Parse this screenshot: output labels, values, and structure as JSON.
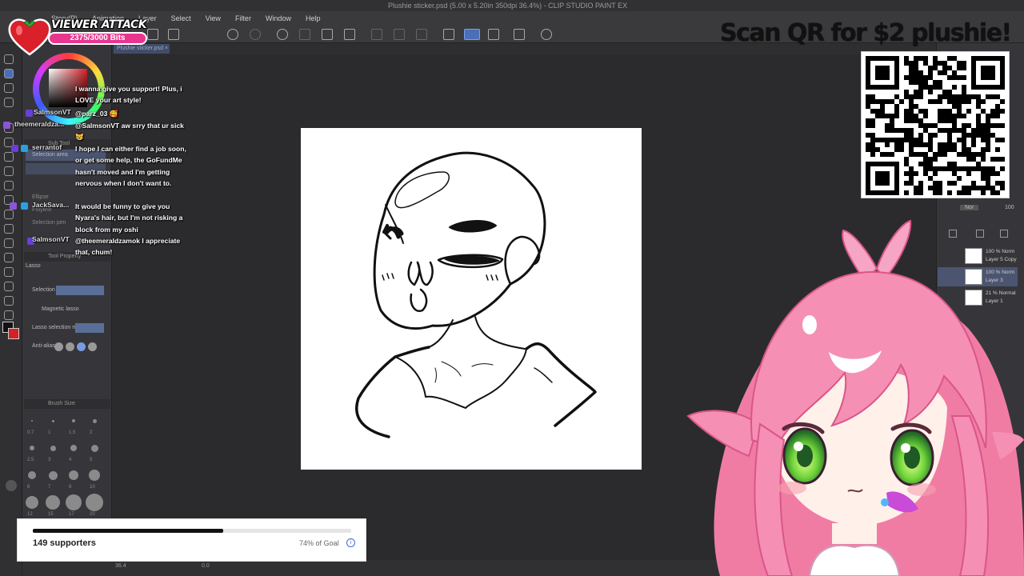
{
  "window": {
    "title": "Plushie sticker.psd (5.00 x 5.20in 350dpi 36.4%) - CLIP STUDIO PAINT EX",
    "doc_tab": "Plushie sticker.psd",
    "menu": [
      "Story(P)",
      "Animation",
      "Layer",
      "Select",
      "View",
      "Filter",
      "Window",
      "Help"
    ]
  },
  "left_panel": {
    "sub_tool_header": "Sub Tool",
    "sub_tools": [
      "Selection area",
      "Ellipse",
      "Polyline",
      "Selection pen"
    ],
    "tool_property_header": "Tool Property",
    "tool_name": "Lasso",
    "selection_label": "Selection",
    "magnetic_lasso": "Magnetic lasso",
    "lasso_mode": "Lasso selection mode",
    "anti_alias": "Anti-alias",
    "brush_size_header": "Brush Size",
    "brush_sizes": [
      "0.7",
      "1",
      "1.5",
      "2",
      "2.5",
      "3",
      "4",
      "5",
      "6",
      "7",
      "8",
      "10",
      "12",
      "15",
      "17",
      "20"
    ],
    "status_zoom": "36.4",
    "status_angle": "0.0"
  },
  "right_panel": {
    "blend_mode": "Nor",
    "opacity": "100",
    "layers": [
      {
        "pct": "100 % Norm",
        "name": "Layer 5 Copy"
      },
      {
        "pct": "100 % Norm",
        "name": "Layer 3"
      },
      {
        "pct": "21 % Normal",
        "name": "Layer 1"
      }
    ]
  },
  "viewer_attack": {
    "title": "VIEWER ATTACK",
    "bits": "2375/3000 Bits",
    "progress": 0.79
  },
  "chat": [
    {
      "user": "",
      "color": "#ffffff",
      "text": "I wanna give you support! Plus, i LOVE your art style!"
    },
    {
      "user": "SalmsonVT",
      "color": "#4b9bff",
      "text": "@parz_03 🥰"
    },
    {
      "user": "theemeraldza...",
      "color": "#b36bff",
      "text": "@SalmsonVT aw srry that ur sick 😿"
    },
    {
      "user": "serrantof",
      "color": "#4b9bff",
      "text": "I hope I can either find a job soon, or get some help, the GoFundMe hasn't moved and I'm getting nervous when I don't want to."
    },
    {
      "user": "JackSava...",
      "color": "#5cff5c",
      "text": "It would be funny to give you Nyara's hair, but I'm not risking a block from my oshi"
    },
    {
      "user": "SalmsonVT",
      "color": "#4b9bff",
      "text": "@theemeraldzamok I appreciate that, chum!"
    }
  ],
  "qr": {
    "title": "Scan QR for $2 plushie!"
  },
  "goal": {
    "supporters": "149 supporters",
    "percent_label": "74% of Goal",
    "progress": 0.74,
    "info_icon": "info-icon"
  },
  "colors": {
    "accent_pink": "#e8368f",
    "canvas_bg": "#ffffff",
    "app_bg": "#2b2b2d"
  }
}
